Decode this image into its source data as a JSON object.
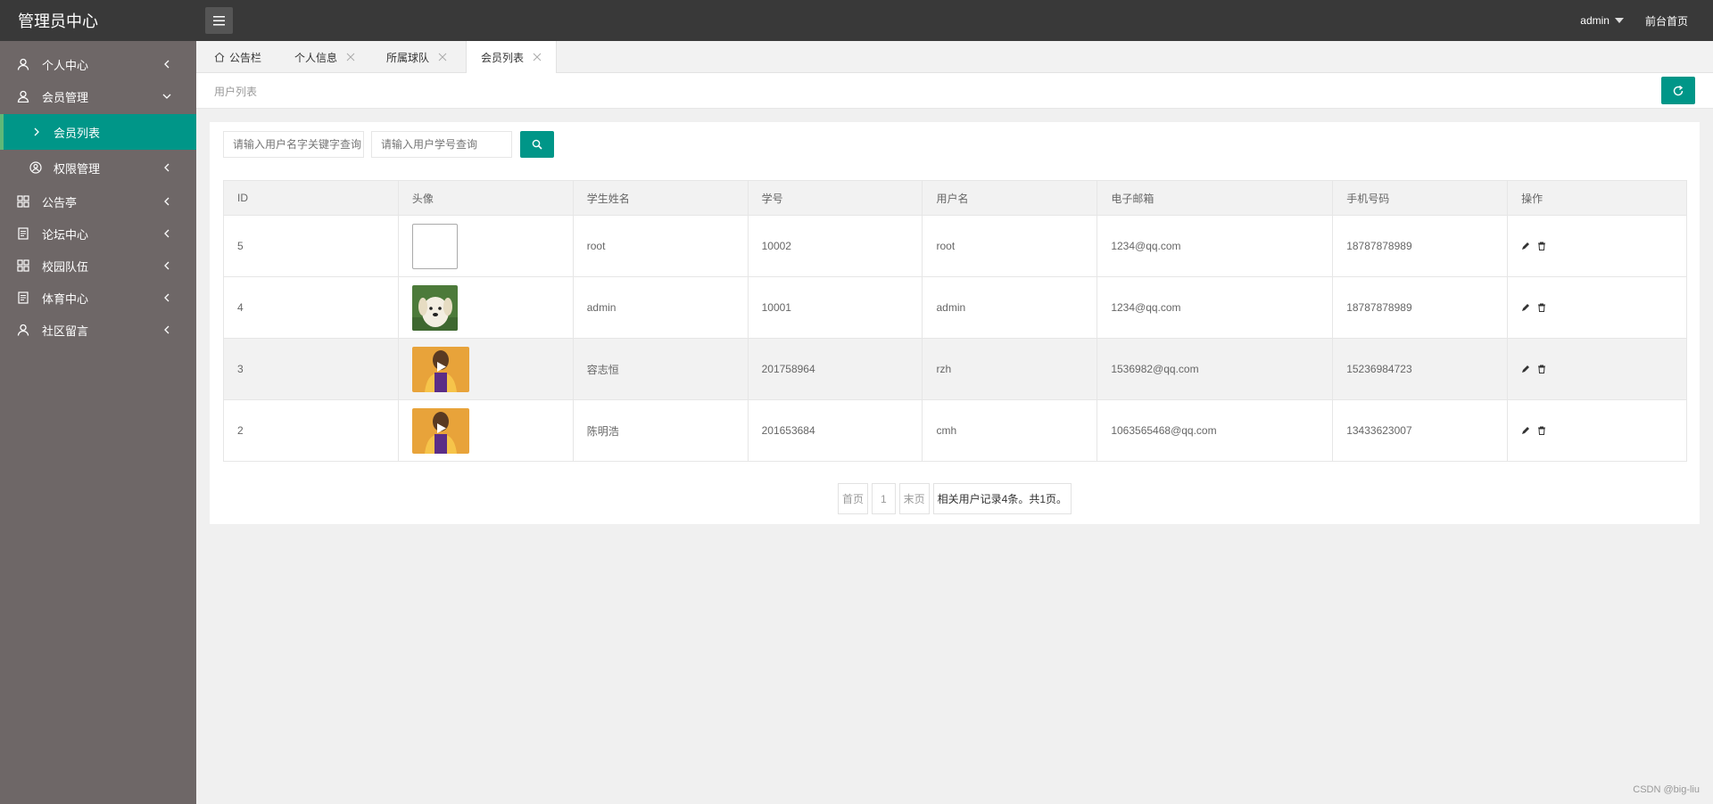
{
  "header": {
    "brand": "管理员中心",
    "user": "admin",
    "front_link": "前台首页"
  },
  "sidebar": {
    "items": [
      {
        "label": "个人中心",
        "icon": "user-icon"
      },
      {
        "label": "会员管理",
        "icon": "members-icon"
      },
      {
        "label": "会员列表",
        "icon": "chevron-right-icon"
      },
      {
        "label": "权限管理",
        "icon": "permission-icon"
      },
      {
        "label": "公告亭",
        "icon": "grid-icon"
      },
      {
        "label": "论坛中心",
        "icon": "document-icon"
      },
      {
        "label": "校园队伍",
        "icon": "grid-icon"
      },
      {
        "label": "体育中心",
        "icon": "document-icon"
      },
      {
        "label": "社区留言",
        "icon": "user-icon"
      }
    ]
  },
  "tabs": [
    {
      "label": "公告栏",
      "icon": "home-icon"
    },
    {
      "label": "个人信息"
    },
    {
      "label": "所属球队"
    },
    {
      "label": "会员列表"
    }
  ],
  "breadcrumb": "用户列表",
  "search": {
    "name_placeholder": "请输入用户名字关键字查询",
    "id_placeholder": "请输入用户学号查询"
  },
  "table": {
    "headers": [
      "ID",
      "头像",
      "学生姓名",
      "学号",
      "用户名",
      "电子邮箱",
      "手机号码",
      "操作"
    ],
    "rows": [
      {
        "id": "5",
        "avatar": "broken-image",
        "name": "root",
        "student_no": "10002",
        "username": "root",
        "email": "1234@qq.com",
        "phone": "18787878989"
      },
      {
        "id": "4",
        "avatar": "puppy-photo",
        "name": "admin",
        "student_no": "10001",
        "username": "admin",
        "email": "1234@qq.com",
        "phone": "18787878989"
      },
      {
        "id": "3",
        "avatar": "basketball-player-photo",
        "name": "容志恒",
        "student_no": "201758964",
        "username": "rzh",
        "email": "1536982@qq.com",
        "phone": "15236984723"
      },
      {
        "id": "2",
        "avatar": "basketball-player-photo",
        "name": "陈明浩",
        "student_no": "201653684",
        "username": "cmh",
        "email": "1063565468@qq.com",
        "phone": "13433623007"
      }
    ]
  },
  "pager": {
    "first": "首页",
    "page": "1",
    "last": "末页",
    "summary": "相关用户记录4条。共1页。"
  },
  "watermark": "CSDN @big-liu",
  "colors": {
    "accent": "#009688",
    "header": "#393939",
    "sidebar": "#6e6767"
  }
}
